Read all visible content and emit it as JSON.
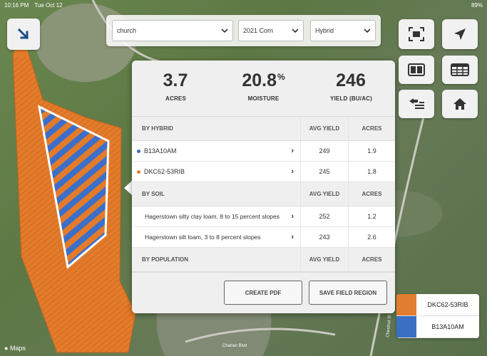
{
  "status_bar": {
    "time": "10:16 PM",
    "date": "Tue Oct 12",
    "battery": "89%"
  },
  "filters": {
    "field": "church",
    "crop": "2021 Corn",
    "layer": "Hybrid"
  },
  "stats": [
    {
      "value": "3.7",
      "unit": "",
      "label": "ACRES"
    },
    {
      "value": "20.8",
      "unit": "%",
      "label": "MOISTURE"
    },
    {
      "value": "246",
      "unit": "",
      "label": "YIELD (BU/AC)"
    }
  ],
  "by_hybrid": {
    "title": "BY HYBRID",
    "col_avg": "AVG YIELD",
    "col_acres": "ACRES",
    "rows": [
      {
        "name": "B13A10AM",
        "avg": "249",
        "acres": "1.9",
        "color": "#3a6fc4"
      },
      {
        "name": "DKC62-53RIB",
        "avg": "245",
        "acres": "1.8",
        "color": "#e07d2e"
      }
    ]
  },
  "by_soil": {
    "title": "BY SOIL",
    "col_avg": "AVG YIELD",
    "col_acres": "ACRES",
    "rows": [
      {
        "name": "Hagerstown silty clay loam, 8 to 15 percent slopes",
        "avg": "252",
        "acres": "1.2"
      },
      {
        "name": "Hagerstown silt loam, 3 to 8 percent slopes",
        "avg": "243",
        "acres": "2.6"
      }
    ]
  },
  "by_population": {
    "title": "BY POPULATION",
    "col_avg": "AVG YIELD",
    "col_acres": "ACRES"
  },
  "actions": {
    "create_pdf": "CREATE PDF",
    "save_region": "SAVE FIELD REGION"
  },
  "legend": [
    {
      "label": "DKC62-53RIB",
      "color": "#e07d2e"
    },
    {
      "label": "B13A10AM",
      "color": "#3a6fc4"
    }
  ],
  "map": {
    "attribution": "Maps",
    "road_label": "Charlan Blvd",
    "road_label_2": "Chestnut St"
  },
  "icons": {
    "collapse": "arrow-down-right-icon",
    "fullscreen": "fullscreen-icon",
    "locate": "location-arrow-icon",
    "split": "split-view-icon",
    "table": "table-icon",
    "back": "back-list-icon",
    "home": "home-icon"
  }
}
